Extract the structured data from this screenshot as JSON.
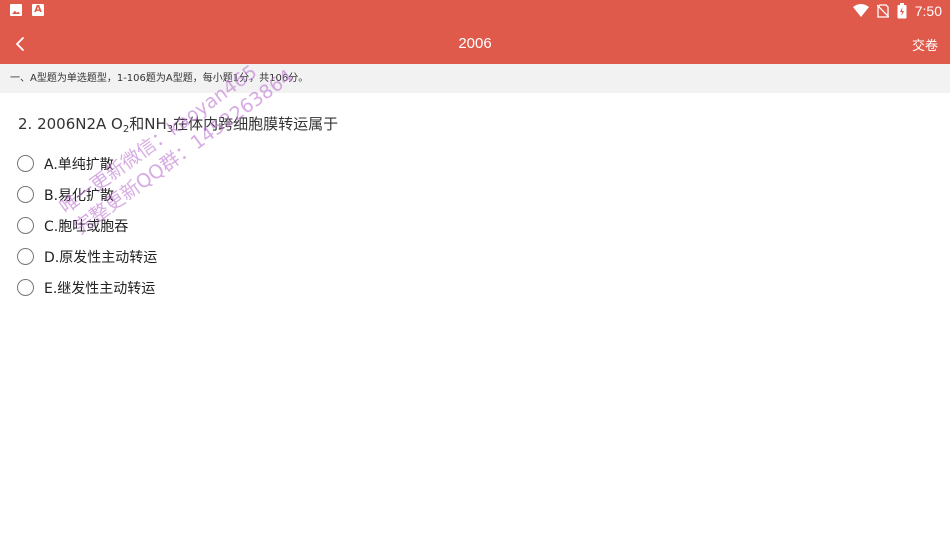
{
  "status_bar": {
    "time": "7:50",
    "left_icons": [
      "image-icon",
      "a-icon"
    ],
    "right_icons": [
      "wifi-icon",
      "no-sim-icon",
      "battery-icon"
    ]
  },
  "app_bar": {
    "title": "2006",
    "submit_label": "交卷",
    "back_icon": "chevron-left-icon"
  },
  "instructions": "一、A型题为单选题型，1-106题为A型题，每小题1分，共106分。",
  "question": {
    "prefix": "2. 2006N2A O",
    "sub1": "2",
    "mid": "和NH",
    "sub2": "3",
    "suffix": "在体内跨细胞膜转运属于"
  },
  "options": [
    {
      "label": "A.单纯扩散"
    },
    {
      "label": "B.易化扩散"
    },
    {
      "label": "C.胞吐或胞吞"
    },
    {
      "label": "D.原发性主动转运"
    },
    {
      "label": "E.继发性主动转运"
    }
  ],
  "watermark": {
    "line1": "唯一更新微信：kaoyan465",
    "line2": "完整更新QQ群：1452263864"
  },
  "colors": {
    "primary": "#e05a4c",
    "instruction_bg": "#f2f2f2",
    "watermark": "#c07ad2"
  }
}
